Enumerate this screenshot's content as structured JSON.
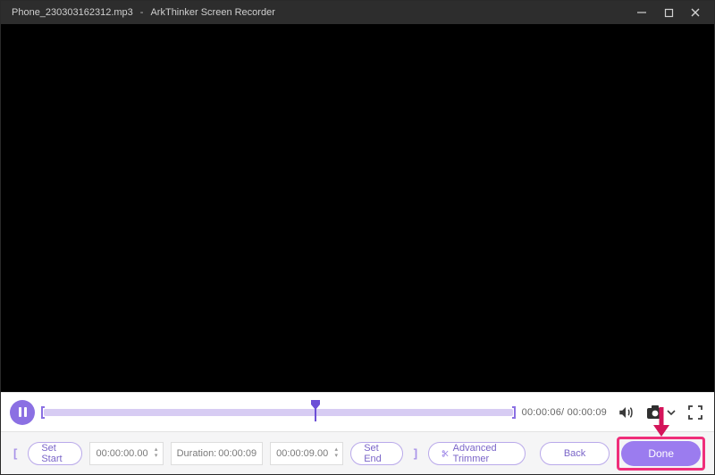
{
  "titlebar": {
    "filename": "Phone_230303162312.mp3",
    "separator": "-",
    "app_name": "ArkThinker Screen Recorder"
  },
  "playback": {
    "playhead_percent": 58,
    "current_time": "00:00:06",
    "time_separator": "/",
    "total_time": " 00:00:09"
  },
  "toolbar": {
    "set_start_label": "Set Start",
    "start_time": "00:00:00.00",
    "duration_label": "Duration:",
    "duration_value": "00:00:09",
    "end_time": "00:00:09.00",
    "set_end_label": "Set End",
    "advanced_trimmer_label": "Advanced Trimmer",
    "back_label": "Back",
    "done_label": "Done"
  }
}
